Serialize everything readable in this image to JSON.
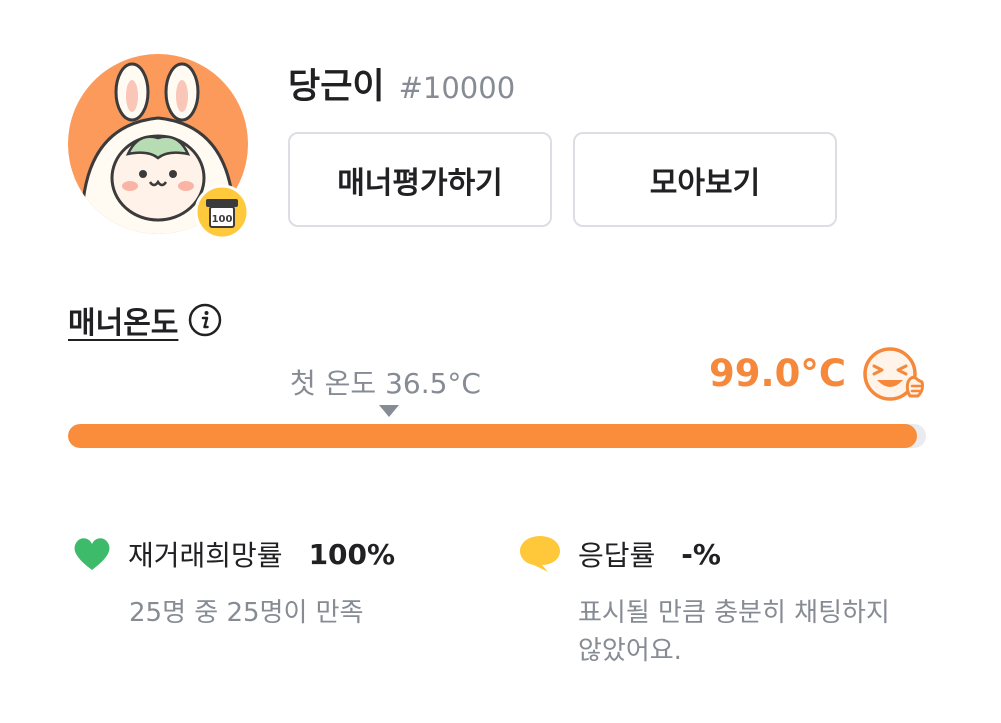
{
  "profile": {
    "nickname": "당근이",
    "user_id": "#10000",
    "badge_text": "100"
  },
  "buttons": {
    "rate_manner": "매너평가하기",
    "collect": "모아보기"
  },
  "manner": {
    "title": "매너온도",
    "first_temp_label": "첫 온도 36.5°C",
    "current_temp": "99.0°C",
    "temp_fraction": 0.99
  },
  "stats": {
    "retrade": {
      "label": "재거래희망률",
      "value": "100%",
      "desc": "25명 중 25명이 만족"
    },
    "response": {
      "label": "응답률",
      "value": "-%",
      "desc": "표시될 만큼 충분히 채팅하지 않았어요."
    }
  },
  "colors": {
    "accent": "#f98d3c",
    "temp_text": "#f5883b",
    "heart": "#3dbb6a",
    "bubble": "#ffc83b",
    "muted": "#868b94"
  }
}
